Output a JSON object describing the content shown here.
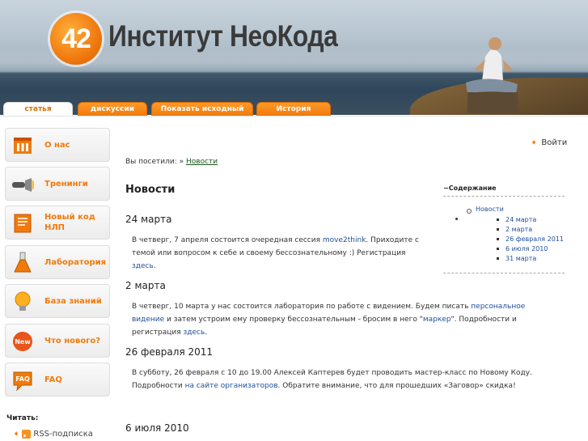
{
  "site": {
    "logo_number": "42",
    "title": "Институт НеоКода"
  },
  "tabs": [
    {
      "label": "статья",
      "active": true
    },
    {
      "label": "дискуссии",
      "active": false
    },
    {
      "label": "Показать исходный текст",
      "active": false
    },
    {
      "label": "История страницы",
      "active": false
    }
  ],
  "sidebar": {
    "items": [
      {
        "label": "О нас",
        "icon": "building-icon"
      },
      {
        "label": "Тренинги",
        "icon": "flashlight-icon"
      },
      {
        "label": "Новый код НЛП",
        "icon": "book-icon"
      },
      {
        "label": "Лаборатория",
        "icon": "flask-icon"
      },
      {
        "label": "База знаний",
        "icon": "lightbulb-icon"
      },
      {
        "label": "Что нового?",
        "icon": "new-badge-icon"
      },
      {
        "label": "FAQ",
        "icon": "faq-icon"
      }
    ],
    "read_title": "Читать:",
    "rss_label": "RSS-подписка"
  },
  "header": {
    "login": "Войти"
  },
  "breadcrumb": {
    "prefix": "Вы посетили: »",
    "link": "Новости"
  },
  "page_title": "Новости",
  "toc": {
    "heading": "−Содержание",
    "root": "Новости",
    "items": [
      "24 марта",
      "2 марта",
      "26 февраля 2011",
      "6 июля 2010",
      "31 марта"
    ]
  },
  "news": [
    {
      "date": "24 марта",
      "t1": "В четверг, 7 апреля состоится очередная сессия ",
      "l1": "move2think",
      "t2": ". Приходите с темой или вопросом к себе и своему бессознательному :) Регистрация ",
      "l2": "здесь",
      "t3": "."
    },
    {
      "date": "2 марта",
      "t1": "В четверг, 10 марта у нас состоится лаборатория по работе с видением. Будем писать ",
      "l1": "персональное видение",
      "t2": " и затем устроим ему проверку бессознательным - бросим в него \"",
      "l2": "маркер",
      "t3": "\". Подробности и регистрация ",
      "l3": "здесь",
      "t4": "."
    },
    {
      "date": "26 февраля 2011",
      "t1": "В субботу, 26 февраля с 10 до 19.00 Алексей Каптерев будет проводить мастер-класс по Новому Коду. Подробности ",
      "l1": "на сайте организаторов",
      "t2": ". Обратите внимание, что для прошедших «Заговор» скидка!"
    },
    {
      "date": "6 июля 2010"
    }
  ],
  "colors": {
    "accent": "#f07a0a",
    "link": "#1f4f9e"
  }
}
